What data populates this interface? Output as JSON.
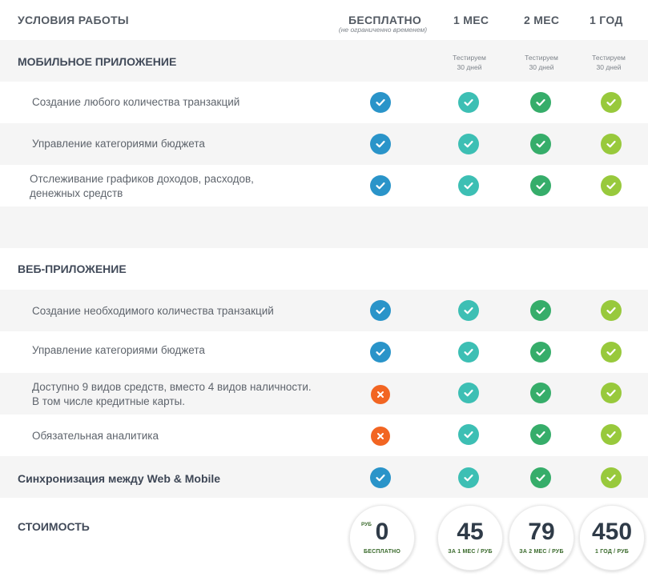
{
  "header": {
    "title": "УСЛОВИЯ РАБОТЫ",
    "plans": [
      {
        "label": "БЕСПЛАТНО",
        "note": "(не ограниченно временем)"
      },
      {
        "label": "1 МЕС"
      },
      {
        "label": "2 МЕС"
      },
      {
        "label": "1 ГОД"
      }
    ]
  },
  "mobile": {
    "title": "МОБИЛЬНОЕ ПРИЛОЖЕНИЕ",
    "test_notes": [
      "Тестируем\n30 дней",
      "Тестируем\n30 дней",
      "Тестируем\n30 дней"
    ],
    "features": [
      {
        "label": "Создание любого количества транзакций",
        "free": "check",
        "m1": "check",
        "m2": "check",
        "y1": "check"
      },
      {
        "label": "Управление категориями бюджета",
        "free": "check",
        "m1": "check",
        "m2": "check",
        "y1": "check"
      },
      {
        "label": "Отслеживание графиков доходов, расходов,\nденежных средств",
        "free": "check",
        "m1": "check",
        "m2": "check",
        "y1": "check"
      }
    ]
  },
  "web": {
    "title": "ВЕБ-ПРИЛОЖЕНИЕ",
    "features": [
      {
        "label": "Создание необходимого количества транзакций",
        "free": "check",
        "m1": "check",
        "m2": "check",
        "y1": "check"
      },
      {
        "label": "Управление категориями бюджета",
        "free": "check",
        "m1": "check",
        "m2": "check",
        "y1": "check"
      },
      {
        "label": "Доступно 9 видов средств, вместо 4 видов наличности.\nВ том числе кредитные карты.",
        "free": "cross",
        "m1": "check",
        "m2": "check",
        "y1": "check"
      },
      {
        "label": "Обязательная аналитика",
        "free": "cross",
        "m1": "check",
        "m2": "check",
        "y1": "check"
      }
    ]
  },
  "sync": {
    "label": "Синхронизация между Web & Mobile",
    "free": "check",
    "m1": "check",
    "m2": "check",
    "y1": "check"
  },
  "cost": {
    "title": "СТОИМОСТЬ",
    "prices": [
      {
        "currency": "РУБ",
        "value": "0",
        "caption": "БЕСПЛАТНО"
      },
      {
        "value": "45",
        "caption": "ЗА 1 МЕС / РУБ"
      },
      {
        "value": "79",
        "caption": "ЗА 2 МЕС / РУБ"
      },
      {
        "value": "450",
        "caption": "1 ГОД / РУБ"
      }
    ]
  },
  "colors": {
    "free": "#2a94c9",
    "m1": "#3dbfb4",
    "m2": "#36ad6a",
    "y1": "#98c93c",
    "cross": "#f26522"
  },
  "icons": {
    "check": "check-icon",
    "cross": "close-icon"
  }
}
